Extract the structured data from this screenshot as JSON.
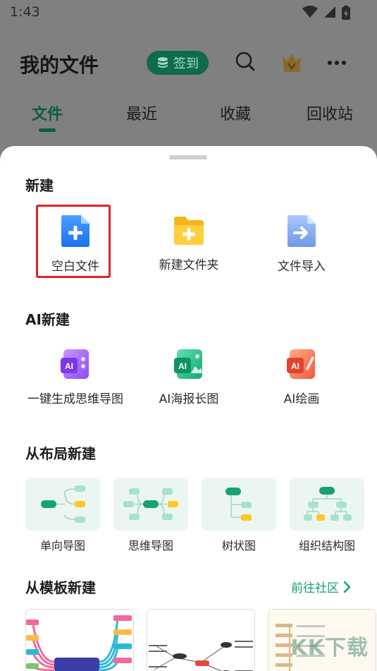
{
  "status_bar": {
    "time": "1:43"
  },
  "header": {
    "title": "我的文件",
    "checkin_label": "签到"
  },
  "tabs": [
    {
      "label": "文件",
      "active": true
    },
    {
      "label": "最近",
      "active": false
    },
    {
      "label": "收藏",
      "active": false
    },
    {
      "label": "回收站",
      "active": false
    }
  ],
  "sheet": {
    "new_section": {
      "title": "新建",
      "items": [
        {
          "label": "空白文件",
          "icon": "blank-file-icon"
        },
        {
          "label": "新建文件夹",
          "icon": "new-folder-icon"
        },
        {
          "label": "文件导入",
          "icon": "file-import-icon"
        }
      ]
    },
    "ai_section": {
      "title": "AI新建",
      "items": [
        {
          "label": "一键生成思维导图",
          "icon": "ai-mindmap-icon"
        },
        {
          "label": "AI海报长图",
          "icon": "ai-poster-icon"
        },
        {
          "label": "AI绘画",
          "icon": "ai-painting-icon"
        }
      ]
    },
    "layout_section": {
      "title": "从布局新建",
      "items": [
        {
          "label": "单向导图"
        },
        {
          "label": "思维导图"
        },
        {
          "label": "树状图"
        },
        {
          "label": "组织结构图"
        }
      ]
    },
    "template_section": {
      "title": "从模板新建",
      "community_link": "前往社区"
    }
  },
  "watermark": "KK下载",
  "colors": {
    "brand_green": "#0f6b4b",
    "accent_green": "#12a072",
    "highlight_red": "#e32222",
    "layout_card_bg": "#ebf6f1"
  }
}
